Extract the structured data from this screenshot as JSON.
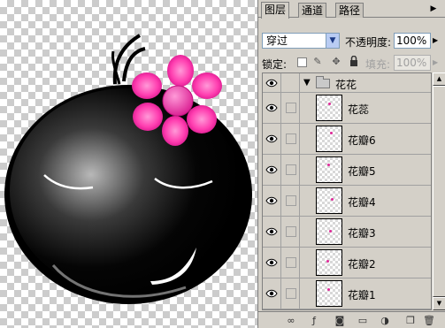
{
  "panel": {
    "tabs": [
      {
        "label": "图层",
        "active": true
      },
      {
        "label": "通道",
        "active": false
      },
      {
        "label": "路径",
        "active": false
      }
    ],
    "menu_icon": "panel-menu-arrow-icon",
    "blend_mode": "穿过",
    "opacity_label": "不透明度:",
    "opacity_value": "100%",
    "lock_label": "锁定:",
    "lock_icons": [
      "lock-transparent-icon",
      "lock-paint-icon",
      "lock-move-icon",
      "lock-all-icon"
    ],
    "fill_label": "填充:",
    "fill_value": "100%"
  },
  "layers": {
    "group": {
      "name": "花花",
      "expanded": true,
      "visible": true
    },
    "items": [
      {
        "name": "花蕊",
        "visible": true
      },
      {
        "name": "花瓣6",
        "visible": true
      },
      {
        "name": "花瓣5",
        "visible": true
      },
      {
        "name": "花瓣4",
        "visible": true
      },
      {
        "name": "花瓣3",
        "visible": true
      },
      {
        "name": "花瓣2",
        "visible": true
      },
      {
        "name": "花瓣1",
        "visible": true
      }
    ]
  },
  "bottom_toolbar": {
    "icons": [
      "link-layers-icon",
      "add-layer-style-icon",
      "add-mask-icon",
      "new-group-icon",
      "adjustment-layer-icon",
      "new-layer-icon",
      "delete-layer-icon"
    ]
  },
  "colors": {
    "panel_bg": "#d4d0c8",
    "flower": "#ff3eb0",
    "face": "#000000"
  }
}
